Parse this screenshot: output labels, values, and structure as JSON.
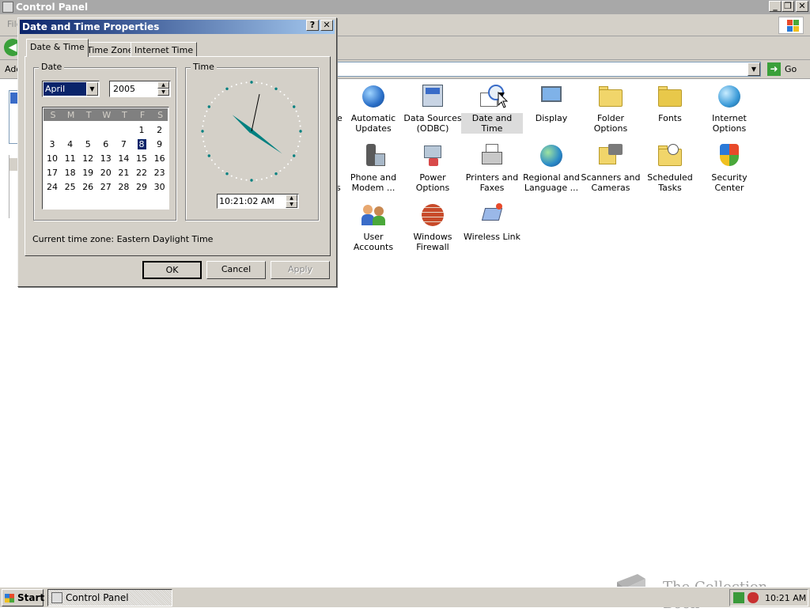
{
  "control_panel": {
    "title": "Control Panel",
    "menu_fragment": "File",
    "address_label": "Address",
    "address_label_fragment": "Ado",
    "go_label": "Go",
    "left_fragments": [
      "e",
      "s",
      "l"
    ],
    "items": [
      {
        "label": "Automatic Updates",
        "icon": "automatic-updates-icon"
      },
      {
        "label": "Data Sources (ODBC)",
        "icon": "data-sources-icon"
      },
      {
        "label": "Date and Time",
        "icon": "date-and-time-icon"
      },
      {
        "label": "Display",
        "icon": "display-icon"
      },
      {
        "label": "Folder Options",
        "icon": "folder-options-icon"
      },
      {
        "label": "Fonts",
        "icon": "fonts-icon"
      },
      {
        "label": "Internet Options",
        "icon": "internet-options-icon"
      },
      {
        "label": "Phone and Modem ...",
        "icon": "phone-and-modem-icon"
      },
      {
        "label": "Power Options",
        "icon": "power-options-icon"
      },
      {
        "label": "Printers and Faxes",
        "icon": "printers-and-faxes-icon"
      },
      {
        "label": "Regional and Language ...",
        "icon": "regional-language-icon"
      },
      {
        "label": "Scanners and Cameras",
        "icon": "scanners-cameras-icon"
      },
      {
        "label": "Scheduled Tasks",
        "icon": "scheduled-tasks-icon"
      },
      {
        "label": "Security Center",
        "icon": "security-center-icon"
      },
      {
        "label": "User Accounts",
        "icon": "user-accounts-icon"
      },
      {
        "label": "Windows Firewall",
        "icon": "windows-firewall-icon"
      },
      {
        "label": "Wireless Link",
        "icon": "wireless-link-icon"
      }
    ]
  },
  "dialog": {
    "title": "Date and Time Properties",
    "help_glyph": "?",
    "close_glyph": "✕",
    "tabs": [
      "Date & Time",
      "Time Zone",
      "Internet Time"
    ],
    "active_tab": "Date & Time",
    "date_group_label": "Date",
    "time_group_label": "Time",
    "month": "April",
    "year": "2005",
    "weekdays": [
      "S",
      "M",
      "T",
      "W",
      "T",
      "F",
      "S"
    ],
    "days": [
      "1",
      "2",
      "3",
      "4",
      "5",
      "6",
      "7",
      "8",
      "9",
      "10",
      "11",
      "12",
      "13",
      "14",
      "15",
      "16",
      "17",
      "18",
      "19",
      "20",
      "21",
      "22",
      "23",
      "24",
      "25",
      "26",
      "27",
      "28",
      "29",
      "30"
    ],
    "first_weekday_index": 5,
    "selected_day": "8",
    "time": "10:21:02 AM",
    "clock": {
      "hour": 10,
      "minute": 21,
      "second": 2
    },
    "timezone_label": "Current time zone:",
    "timezone_value": "Eastern Daylight Time",
    "buttons": {
      "ok": "OK",
      "cancel": "Cancel",
      "apply": "Apply"
    }
  },
  "taskbar": {
    "start_label": "Start",
    "task_label": "Control Panel",
    "clock": "10:21 AM"
  },
  "watermark": "The Collection Book",
  "colors": {
    "title_active_start": "#0a246a",
    "title_active_end": "#a6caf0",
    "title_inactive": "#a8a8a8",
    "face": "#d4d0c8",
    "selection": "#0a246a",
    "clock_hand": "#008080"
  }
}
